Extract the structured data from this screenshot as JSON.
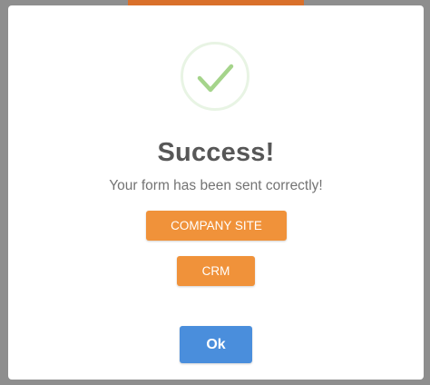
{
  "dialog": {
    "title": "Success!",
    "message": "Your form has been sent correctly!",
    "icon": "check-icon",
    "buttons": {
      "company_site": "COMPANY SITE",
      "crm": "CRM",
      "ok": "Ok"
    },
    "colors": {
      "accent_orange": "#f0923a",
      "confirm_blue": "#4a8edc",
      "check_green": "#a5d48b",
      "background_overlay": "#8e8e8e"
    }
  }
}
